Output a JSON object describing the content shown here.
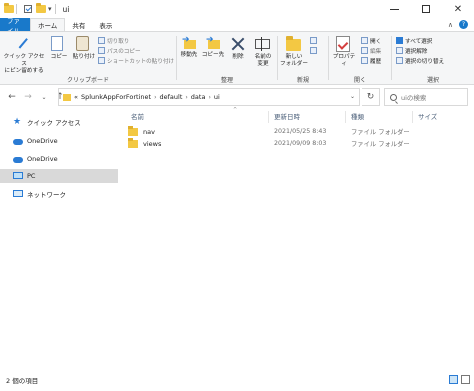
{
  "window": {
    "title": "ui",
    "controls": {
      "minimize": "minimize",
      "maximize": "maximize",
      "close": "✕"
    }
  },
  "ribbon_tabs": [
    {
      "label": "ファイル"
    },
    {
      "label": "ホーム"
    },
    {
      "label": "共有"
    },
    {
      "label": "表示"
    }
  ],
  "ribbon": {
    "clipboard": {
      "label": "クリップボード",
      "pin_line1": "クイック アクセス",
      "pin_line2": "にピン留めする",
      "copy": "コピー",
      "paste": "貼り付け",
      "cut": "切り取り",
      "copy_path": "パスのコピー",
      "paste_shortcut": "ショートカットの貼り付け"
    },
    "organize": {
      "label": "整理",
      "move_to": "移動先",
      "copy_to": "コピー先",
      "delete": "削除",
      "rename_line1": "名前の",
      "rename_line2": "変更"
    },
    "new": {
      "label": "新規",
      "new_folder_line1": "新しい",
      "new_folder_line2": "フォルダー"
    },
    "open": {
      "label": "開く",
      "properties": "プロパティ",
      "open": "開く",
      "edit": "編集",
      "history": "履歴"
    },
    "select": {
      "label": "選択",
      "select_all": "すべて選択",
      "select_none": "選択解除",
      "invert": "選択の切り替え"
    }
  },
  "address": {
    "prefix": "«",
    "crumbs": [
      "SplunkAppForFortinet",
      "default",
      "data",
      "ui"
    ],
    "search_placeholder": "uiの検索"
  },
  "nav_pane": {
    "items": [
      {
        "label": "クイック アクセス",
        "icon": "star-icon"
      },
      {
        "label": "OneDrive",
        "icon": "cloud-icon"
      },
      {
        "label": "OneDrive",
        "icon": "cloud-icon"
      },
      {
        "label": "PC",
        "icon": "pc-icon",
        "selected": true
      },
      {
        "label": "ネットワーク",
        "icon": "network-icon"
      }
    ]
  },
  "file_list": {
    "columns": [
      "名前",
      "更新日時",
      "種類",
      "サイズ"
    ],
    "rows": [
      {
        "name": "nav",
        "modified": "2021/05/25 8:43",
        "type": "ファイル フォルダー",
        "size": ""
      },
      {
        "name": "views",
        "modified": "2021/09/09 8:03",
        "type": "ファイル フォルダー",
        "size": ""
      }
    ]
  },
  "status_bar": {
    "item_count": "2 個の項目"
  },
  "colors": {
    "accent": "#1979ca",
    "folder": "#f3c843",
    "selected_nav": "#d9d9d9"
  }
}
